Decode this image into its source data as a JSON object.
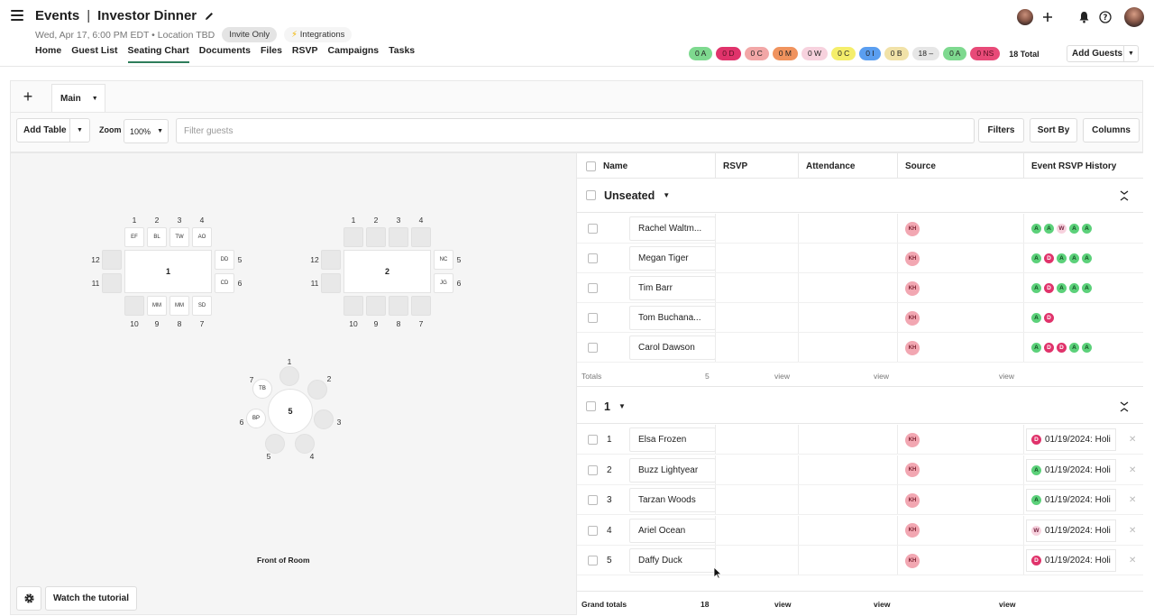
{
  "header": {
    "app": "Events",
    "sep": "|",
    "event_name": "Investor Dinner",
    "datetime": "Wed, Apr 17, 6:00 PM EDT",
    "location": "Location TBD",
    "invite_chip": "Invite Only",
    "integrations_chip": "Integrations",
    "nav": [
      "Home",
      "Guest List",
      "Seating Chart",
      "Documents",
      "Files",
      "RSVP",
      "Campaigns",
      "Tasks"
    ],
    "status_pills": [
      {
        "label": "0 A",
        "color": "#7ed98f"
      },
      {
        "label": "0 D",
        "color": "#e0336b"
      },
      {
        "label": "0 C",
        "color": "#f2a7a7"
      },
      {
        "label": "0 M",
        "color": "#f0935e"
      },
      {
        "label": "0 W",
        "color": "#f7d2de"
      },
      {
        "label": "0 C",
        "color": "#f5ee6b"
      },
      {
        "label": "0 I",
        "color": "#5a9ef0"
      },
      {
        "label": "0 B",
        "color": "#f1e2a8"
      },
      {
        "label": "18 –",
        "color": "#e6e6e6"
      },
      {
        "label": "0 A",
        "color": "#7ed98f"
      },
      {
        "label": "0 NS",
        "color": "#e84a78"
      }
    ],
    "total": "18 Total",
    "add_guests": "Add Guests"
  },
  "tabs": {
    "add": "+",
    "main": "Main"
  },
  "toolbar": {
    "add_table": "Add Table",
    "zoom_label": "Zoom",
    "zoom_value": "100%",
    "filter_placeholder": "Filter guests",
    "filters": "Filters",
    "sort_by": "Sort By",
    "columns": "Columns"
  },
  "canvas": {
    "front_label": "Front of Room",
    "watch_tutorial": "Watch the tutorial",
    "table1": {
      "label": "1",
      "top_nums": [
        "1",
        "2",
        "3",
        "4"
      ],
      "top_seats": [
        "EF",
        "BL",
        "TW",
        "AO"
      ],
      "right_nums": [
        "5",
        "6"
      ],
      "right_seats": [
        "DD",
        "CD"
      ],
      "bottom_nums": [
        "10",
        "9",
        "8",
        "7"
      ],
      "bottom_seats": [
        "",
        "MM",
        "MM",
        "SD"
      ],
      "left_nums": [
        "12",
        "11"
      ]
    },
    "table2": {
      "label": "2",
      "top_nums": [
        "1",
        "2",
        "3",
        "4"
      ],
      "right_nums": [
        "5",
        "6"
      ],
      "right_seats": [
        "NC",
        "JG"
      ],
      "bottom_nums": [
        "10",
        "9",
        "8",
        "7"
      ],
      "left_nums": [
        "12",
        "11"
      ]
    },
    "table5": {
      "label": "5",
      "nums": [
        "1",
        "2",
        "3",
        "4",
        "5",
        "6",
        "7"
      ],
      "seats": [
        "",
        "",
        "",
        "",
        "",
        "BP",
        "TB"
      ]
    }
  },
  "grid": {
    "columns": [
      "Name",
      "RSVP",
      "Attendance",
      "Source",
      "Event RSVP History"
    ],
    "unseated": {
      "name": "Unseated",
      "rows": [
        {
          "name": "Rachel Waltm...",
          "source": "KH",
          "history": [
            "A",
            "A",
            "W",
            "A",
            "A"
          ]
        },
        {
          "name": "Megan Tiger",
          "source": "KH",
          "history": [
            "A",
            "D",
            "A",
            "A",
            "A"
          ]
        },
        {
          "name": "Tim Barr",
          "source": "KH",
          "history": [
            "A",
            "D",
            "A",
            "A",
            "A"
          ]
        },
        {
          "name": "Tom Buchana...",
          "source": "KH",
          "history": [
            "A",
            "D"
          ]
        },
        {
          "name": "Carol Dawson",
          "source": "KH",
          "history": [
            "A",
            "D",
            "D",
            "A",
            "A"
          ]
        }
      ],
      "totals_label": "Totals",
      "totals_count": "5",
      "view": "view"
    },
    "group1": {
      "name": "1",
      "rows": [
        {
          "num": "1",
          "name": "Elsa Frozen",
          "source": "KH",
          "badge": "D",
          "history": "01/19/2024: Holi"
        },
        {
          "num": "2",
          "name": "Buzz Lightyear",
          "source": "KH",
          "badge": "A",
          "history": "01/19/2024: Holi"
        },
        {
          "num": "3",
          "name": "Tarzan Woods",
          "source": "KH",
          "badge": "A",
          "history": "01/19/2024: Holi"
        },
        {
          "num": "4",
          "name": "Ariel Ocean",
          "source": "KH",
          "badge": "W",
          "history": "01/19/2024: Holi"
        },
        {
          "num": "5",
          "name": "Daffy Duck",
          "source": "KH",
          "badge": "D",
          "history": "01/19/2024: Holi"
        }
      ]
    },
    "grand_totals": {
      "label": "Grand totals",
      "count": "18",
      "view": "view"
    }
  }
}
